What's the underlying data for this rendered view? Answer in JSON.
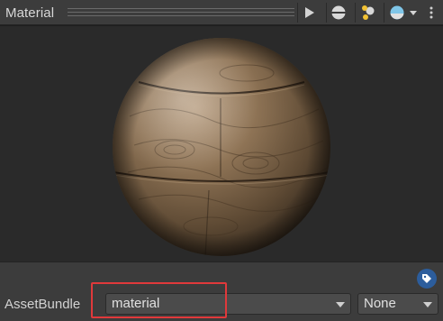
{
  "header": {
    "title": "Material",
    "buttons": [
      {
        "icon": "play-icon"
      },
      {
        "icon": "sphere-shape-icon"
      },
      {
        "icon": "light-icon"
      },
      {
        "icon": "preview-color-icon"
      }
    ]
  },
  "preview": {
    "object": "wood-sphere"
  },
  "asset_bundle": {
    "label": "AssetBundle",
    "name_value": "material",
    "variant_value": "None"
  },
  "colors": {
    "highlight": "#e0393b",
    "tag_button": "#2c5d9c"
  }
}
